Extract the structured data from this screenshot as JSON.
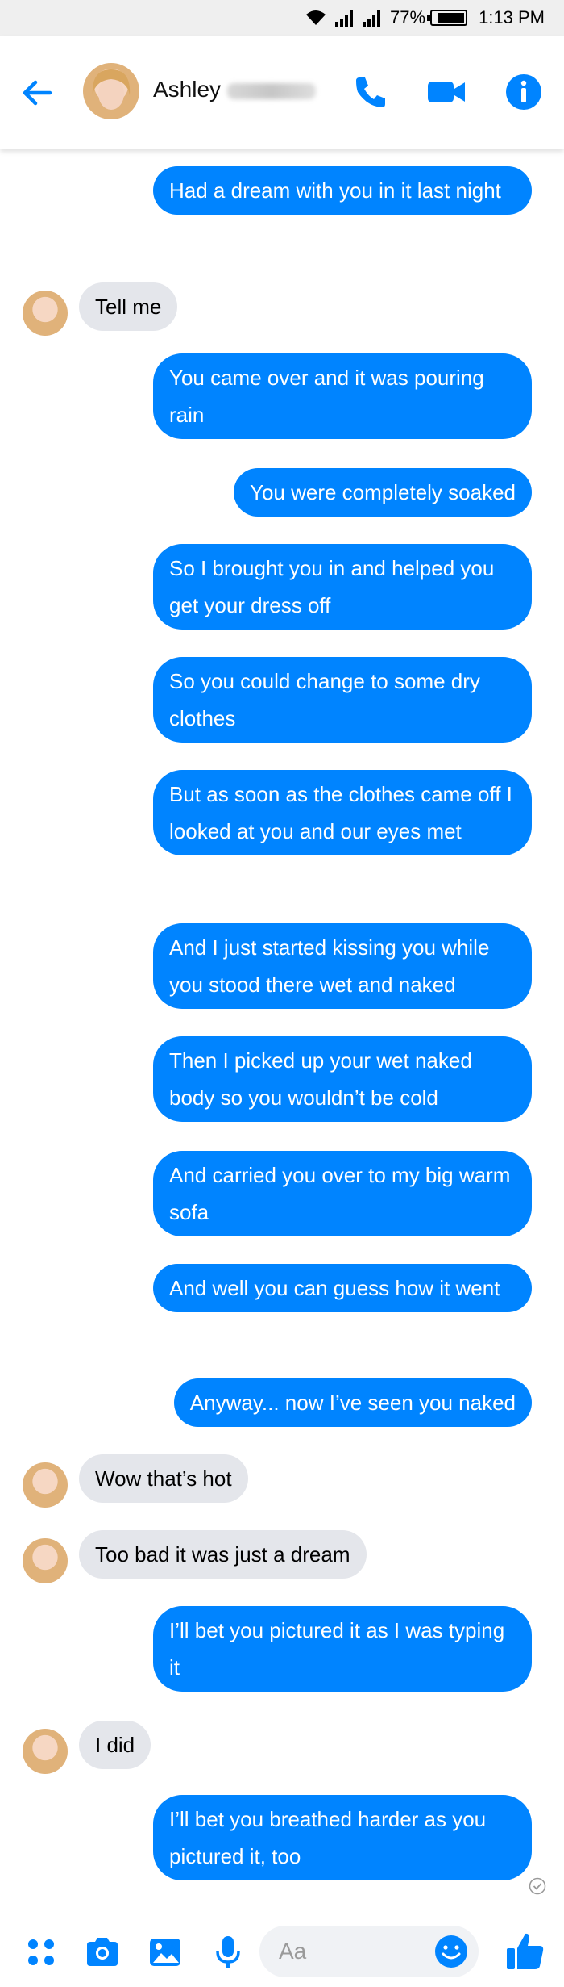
{
  "status_bar": {
    "battery": "77%",
    "time": "1:13 PM"
  },
  "header": {
    "contact_first_name": "Ashley",
    "back_icon": "back-arrow-icon",
    "call_icon": "phone-icon",
    "video_icon": "video-camera-icon",
    "info_icon": "info-icon"
  },
  "colors": {
    "accent": "#0084ff",
    "incoming_bubble": "#e4e6eb",
    "status_bar_bg": "#efefef"
  },
  "messages": [
    {
      "dir": "out",
      "text": "Had a dream with you in it last night"
    },
    {
      "dir": "in",
      "text": "Tell me"
    },
    {
      "dir": "out",
      "text": "You came over and it was pouring rain"
    },
    {
      "dir": "out",
      "text": "You were completely soaked"
    },
    {
      "dir": "out",
      "text": "So I brought you in and helped you get your dress off"
    },
    {
      "dir": "out",
      "text": "So you could change to some dry clothes"
    },
    {
      "dir": "out",
      "text": "But as soon as the clothes came off I looked at you and our eyes met"
    },
    {
      "dir": "out",
      "text": "And I just started kissing you while you stood there wet and naked"
    },
    {
      "dir": "out",
      "text": "Then I picked up your wet naked body so you wouldn’t be cold"
    },
    {
      "dir": "out",
      "text": "And carried you over to my big warm sofa"
    },
    {
      "dir": "out",
      "text": "And well you can guess how it went"
    },
    {
      "dir": "out",
      "text": "Anyway... now I’ve seen you naked"
    },
    {
      "dir": "in",
      "text": "Wow that’s hot"
    },
    {
      "dir": "in",
      "text": "Too bad it was just a dream"
    },
    {
      "dir": "out",
      "text": "I’ll bet you pictured it as I was typing it"
    },
    {
      "dir": "in",
      "text": "I did"
    },
    {
      "dir": "out",
      "text": "I’ll bet you breathed harder as you pictured it, too"
    }
  ],
  "composer": {
    "placeholder": "Aa",
    "value": "",
    "icons": [
      "apps-icon",
      "camera-icon",
      "gallery-icon",
      "microphone-icon",
      "emoji-icon",
      "thumbs-up-icon"
    ]
  }
}
